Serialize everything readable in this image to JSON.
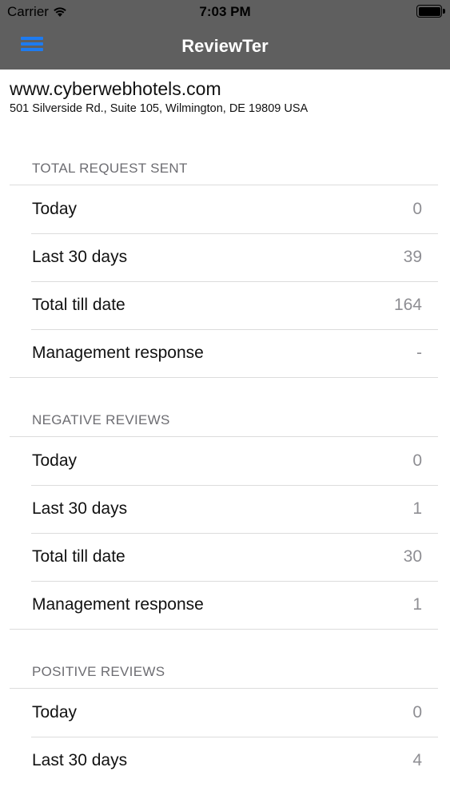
{
  "status_bar": {
    "carrier": "Carrier",
    "time": "7:03 PM"
  },
  "nav": {
    "title": "ReviewTer"
  },
  "hotel": {
    "name": "www.cyberwebhotels.com",
    "address": "501 Silverside Rd., Suite 105, Wilmington, DE 19809 USA"
  },
  "sections": [
    {
      "header": "TOTAL REQUEST SENT",
      "rows": [
        {
          "label": "Today",
          "value": "0"
        },
        {
          "label": "Last 30 days",
          "value": "39"
        },
        {
          "label": "Total till date",
          "value": "164"
        },
        {
          "label": "Management response",
          "value": "-"
        }
      ]
    },
    {
      "header": "NEGATIVE REVIEWS",
      "rows": [
        {
          "label": "Today",
          "value": "0"
        },
        {
          "label": "Last 30 days",
          "value": "1"
        },
        {
          "label": "Total till date",
          "value": "30"
        },
        {
          "label": "Management response",
          "value": "1"
        }
      ]
    },
    {
      "header": "POSITIVE REVIEWS",
      "rows": [
        {
          "label": "Today",
          "value": "0"
        },
        {
          "label": "Last 30 days",
          "value": "4"
        }
      ]
    }
  ],
  "colors": {
    "nav_background": "#5f5f5f",
    "menu_icon": "#1e7bf0",
    "value_text": "#8e8e93",
    "section_header": "#6d6d72"
  }
}
